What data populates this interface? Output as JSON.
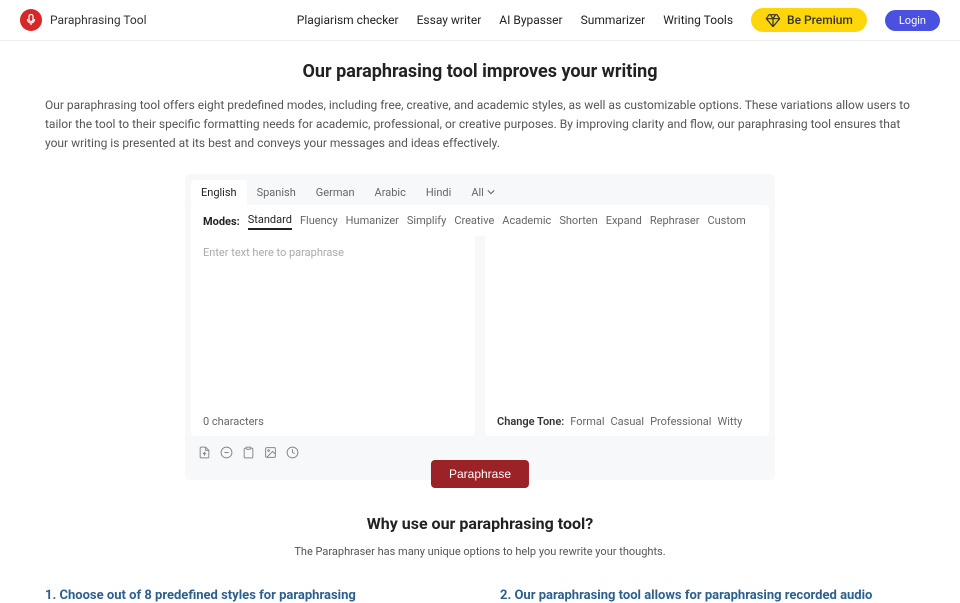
{
  "header": {
    "brand": "Paraphrasing Tool",
    "nav": [
      "Plagiarism checker",
      "Essay writer",
      "AI Bypasser",
      "Summarizer",
      "Writing Tools"
    ],
    "premium": "Be Premium",
    "login": "Login"
  },
  "page": {
    "title": "Our paraphrasing tool improves your writing",
    "intro": "Our paraphrasing tool offers eight predefined modes, including free, creative, and academic styles, as well as customizable options. These variations allow users to tailor the tool to their specific formatting needs for academic, professional, or creative purposes. By improving clarity and flow, our paraphrasing tool ensures that your writing is presented at its best and conveys your messages and ideas effectively."
  },
  "tool": {
    "languages": [
      "English",
      "Spanish",
      "German",
      "Arabic",
      "Hindi",
      "All"
    ],
    "active_lang": "English",
    "modes_label": "Modes:",
    "modes": [
      "Standard",
      "Fluency",
      "Humanizer",
      "Simplify",
      "Creative",
      "Academic",
      "Shorten",
      "Expand",
      "Rephraser",
      "Custom"
    ],
    "active_mode": "Standard",
    "placeholder": "Enter text here to paraphrase",
    "char_count": "0 characters",
    "tone_label": "Change Tone:",
    "tones": [
      "Formal",
      "Casual",
      "Professional",
      "Witty"
    ],
    "button": "Paraphrase"
  },
  "why": {
    "title": "Why use our paraphrasing tool?",
    "sub": "The Paraphraser has many unique options to help you rewrite your thoughts."
  },
  "features": {
    "h1": "1. Choose out of 8 predefined styles for paraphrasing",
    "h2": "2. Our paraphrasing tool allows for paraphrasing recorded audio"
  }
}
